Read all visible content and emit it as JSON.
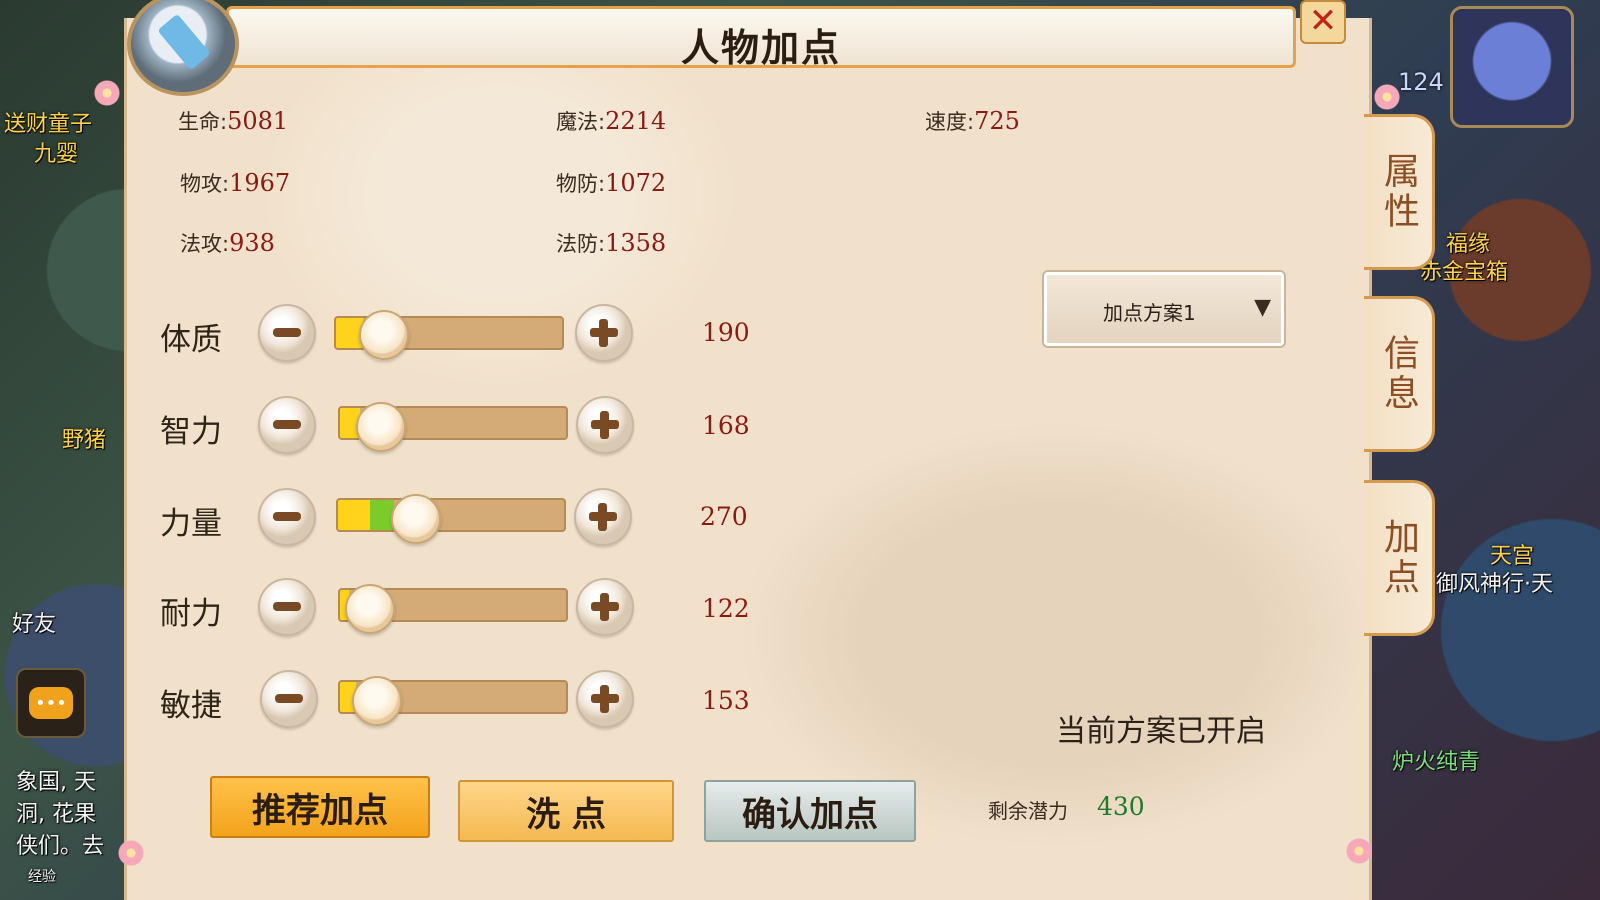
{
  "window": {
    "title": "人物加点"
  },
  "world": {
    "labels": [
      "送财童子",
      "九婴",
      "野猪",
      "好友",
      "福缘",
      "赤金宝箱",
      "天宫",
      "御风神行·天",
      "炉火纯青",
      "象国, 天",
      "洞, 花果",
      "侠们。去",
      "经验"
    ],
    "level": "124"
  },
  "stats": [
    {
      "label": "生命:",
      "value": "5081"
    },
    {
      "label": "魔法:",
      "value": "2214"
    },
    {
      "label": "速度:",
      "value": "725"
    },
    {
      "label": "物攻:",
      "value": "1967"
    },
    {
      "label": "物防:",
      "value": "1072"
    },
    {
      "label": "法攻:",
      "value": "938"
    },
    {
      "label": "法防:",
      "value": "1358"
    }
  ],
  "attributes": [
    {
      "label": "体质",
      "value": "190",
      "base_fraction": 0.12,
      "added_fraction": 0.0
    },
    {
      "label": "智力",
      "value": "168",
      "base_fraction": 0.09,
      "added_fraction": 0.0
    },
    {
      "label": "力量",
      "value": "270",
      "base_fraction": 0.14,
      "added_fraction": 0.11
    },
    {
      "label": "耐力",
      "value": "122",
      "base_fraction": 0.04,
      "added_fraction": 0.0
    },
    {
      "label": "敏捷",
      "value": "153",
      "base_fraction": 0.07,
      "added_fraction": 0.0
    }
  ],
  "plan": {
    "selected": "加点方案1",
    "arrow": "▼",
    "status": "当前方案已开启"
  },
  "buttons": {
    "recommend": "推荐加点",
    "reset": "洗 点",
    "confirm": "确认加点"
  },
  "remaining": {
    "label": "剩余潜力",
    "value": "430"
  },
  "side_tabs": [
    "属性",
    "信息",
    "加点"
  ],
  "close_icon": "✕",
  "chat_icon": "•••",
  "colors": {
    "panel_bg": "#f1e1cb",
    "value_red": "#8a1a14",
    "remaining_green": "#1f7a2b",
    "accent_orange": "#f3a31c",
    "fill_yellow": "#ffd21c",
    "fill_green": "#7ccb2a"
  }
}
